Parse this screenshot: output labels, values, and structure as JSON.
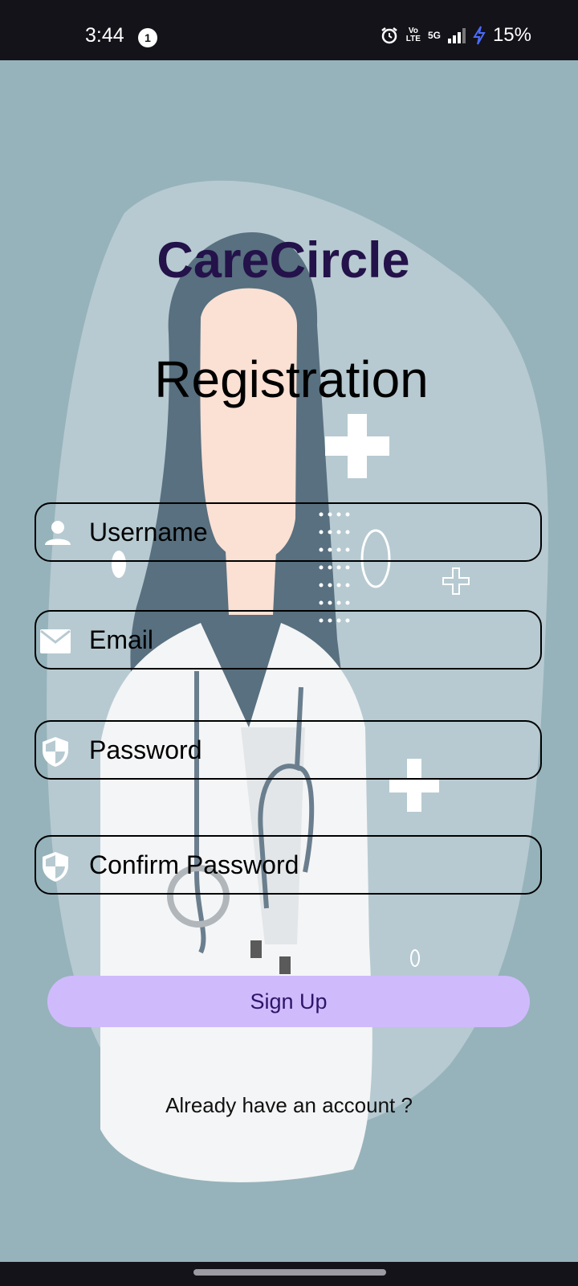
{
  "status_bar": {
    "time": "3:44",
    "notification_count": "1",
    "network_volte": "Vo LTE",
    "network_type": "5G",
    "battery": "15%"
  },
  "app": {
    "name": "CareCircle",
    "page_title": "Registration"
  },
  "form": {
    "username_placeholder": "Username",
    "email_placeholder": "Email",
    "password_placeholder": "Password",
    "confirm_password_placeholder": "Confirm Password",
    "signup_label": "Sign Up",
    "login_prompt": "Already have an account ?"
  },
  "colors": {
    "background": "#96b3bb",
    "title": "#24124a",
    "button": "#cfbbfc",
    "button_text": "#2f1468"
  },
  "icons": {
    "username": "person-icon",
    "email": "mail-icon",
    "password": "shield-icon",
    "confirm_password": "shield-icon"
  }
}
